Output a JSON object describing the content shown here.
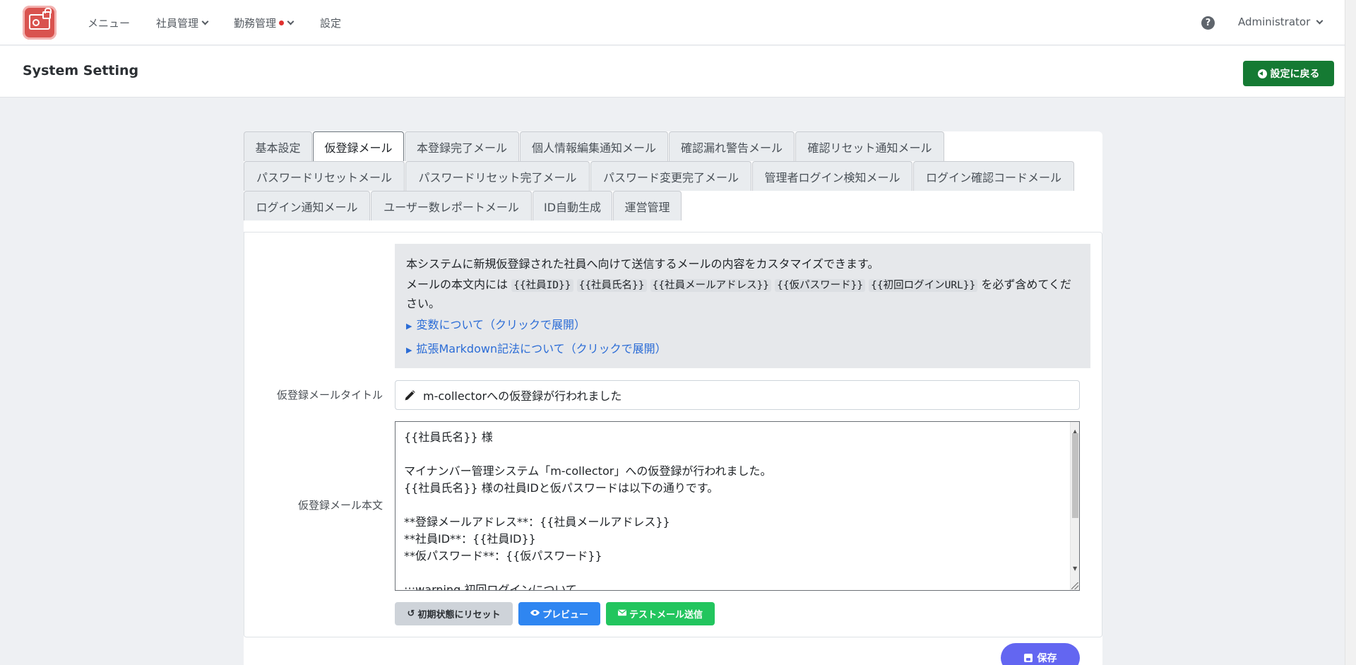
{
  "navbar": {
    "menu": "メニュー",
    "employees": "社員管理",
    "attendance": "勤務管理",
    "settings": "設定",
    "user": "Administrator"
  },
  "header": {
    "title": "System Setting",
    "back_button": "設定に戻る"
  },
  "tabs": [
    {
      "label": "基本設定",
      "active": false
    },
    {
      "label": "仮登録メール",
      "active": true
    },
    {
      "label": "本登録完了メール",
      "active": false
    },
    {
      "label": "個人情報編集通知メール",
      "active": false
    },
    {
      "label": "確認漏れ警告メール",
      "active": false
    },
    {
      "label": "確認リセット通知メール",
      "active": false
    },
    {
      "label": "パスワードリセットメール",
      "active": false
    },
    {
      "label": "パスワードリセット完了メール",
      "active": false
    },
    {
      "label": "パスワード変更完了メール",
      "active": false
    },
    {
      "label": "管理者ログイン検知メール",
      "active": false
    },
    {
      "label": "ログイン確認コードメール",
      "active": false
    },
    {
      "label": "ログイン通知メール",
      "active": false
    },
    {
      "label": "ユーザー数レポートメール",
      "active": false
    },
    {
      "label": "ID自動生成",
      "active": false
    },
    {
      "label": "運営管理",
      "active": false
    }
  ],
  "info": {
    "line1": "本システムに新規仮登録された社員へ向けて送信するメールの内容をカスタマイズできます。",
    "line2_prefix": "メールの本文内には",
    "variables": [
      "{{社員ID}}",
      "{{社員氏名}}",
      "{{社員メールアドレス}}",
      "{{仮パスワード}}",
      "{{初回ログインURL}}"
    ],
    "line2_suffix": "を必ず含めてください。",
    "toggle_variables": "変数について（クリックで展開）",
    "toggle_markdown": "拡張Markdown記法について（クリックで展開）"
  },
  "form": {
    "title_label": "仮登録メールタイトル",
    "title_value": "m-collectorへの仮登録が行われました",
    "body_label": "仮登録メール本文",
    "body_lines": [
      "{{社員氏名}} 様",
      "",
      "マイナンバー管理システム「m-collector」への仮登録が行われました。",
      "{{社員氏名}} 様の社員IDと仮パスワードは以下の通りです。",
      "",
      "**登録メールアドレス**：{{社員メールアドレス}}",
      "**社員ID**：{{社員ID}}",
      "**仮パスワード**：{{仮パスワード}}",
      "",
      ":::warning 初回ログインについて"
    ]
  },
  "buttons": {
    "reset": "初期状態にリセット",
    "preview": "プレビュー",
    "test_mail": "テストメール送信",
    "save": "保存"
  },
  "colors": {
    "primary_green": "#157a33",
    "preview_blue": "#2f86f1",
    "test_green": "#22c55e",
    "save_indigo": "#6366f1",
    "logo_red": "#d9534f"
  }
}
